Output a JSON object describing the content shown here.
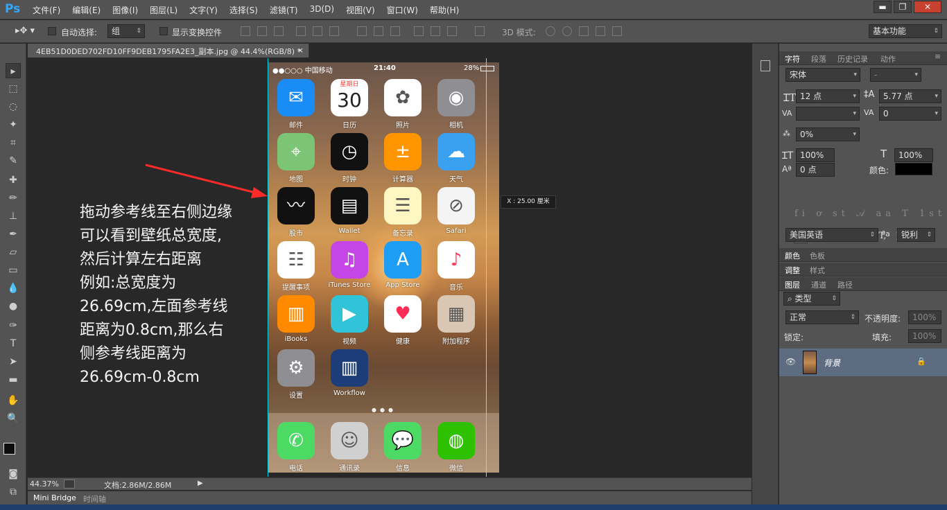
{
  "app": {
    "logo": "Ps",
    "workspace": "基本功能"
  },
  "menu": [
    "文件(F)",
    "编辑(E)",
    "图像(I)",
    "图层(L)",
    "文字(Y)",
    "选择(S)",
    "滤镜(T)",
    "3D(D)",
    "视图(V)",
    "窗口(W)",
    "帮助(H)"
  ],
  "window_controls": {
    "minimize": "▬",
    "restore": "❐",
    "close": "✕"
  },
  "options": {
    "auto_select_label": "自动选择:",
    "auto_select_value": "组",
    "transform_label": "显示变换控件",
    "mode3d_label": "3D 模式:"
  },
  "document": {
    "tab_title": "4EB51D0DED702FD10FF9DEB1795FA2E3_副本.jpg @ 44.4%(RGB/8) *",
    "close": "×"
  },
  "status": {
    "zoom": "44.37%",
    "doc_info": "文档:2.86M/2.86M"
  },
  "bottom_tabs": [
    "Mini Bridge",
    "时间轴"
  ],
  "tooltip": "X : 25.00 厘米",
  "annotation": [
    "拖动参考线至右侧边缘",
    "可以看到壁纸总宽度,",
    "然后计算左右距离",
    "例如:总宽度为",
    "26.69cm,左面参考线",
    "距离为0.8cm,那么右",
    "侧参考线距离为",
    "26.69cm-0.8cm"
  ],
  "phone": {
    "carrier": "●●○○○ 中国移动",
    "time": "21:40",
    "battery": "28%",
    "calendar_weekday": "星期日",
    "calendar_day": "30",
    "apps": [
      {
        "name": "邮件",
        "icon": "mail-icon",
        "color": "#1a8cf5"
      },
      {
        "name": "日历",
        "icon": "calendar-icon",
        "color": "#ffffff"
      },
      {
        "name": "照片",
        "icon": "photos-icon",
        "color": "#ffffff"
      },
      {
        "name": "相机",
        "icon": "camera-icon",
        "color": "#8e8e93"
      },
      {
        "name": "地图",
        "icon": "maps-icon",
        "color": "#7cc576"
      },
      {
        "name": "时钟",
        "icon": "clock-icon",
        "color": "#111111"
      },
      {
        "name": "计算器",
        "icon": "calculator-icon",
        "color": "#ff9500"
      },
      {
        "name": "天气",
        "icon": "weather-icon",
        "color": "#3aa0f0"
      },
      {
        "name": "股市",
        "icon": "stocks-icon",
        "color": "#111111"
      },
      {
        "name": "Wallet",
        "icon": "wallet-icon",
        "color": "#111111"
      },
      {
        "name": "备忘录",
        "icon": "notes-icon",
        "color": "#fef7c3"
      },
      {
        "name": "Safari",
        "icon": "safari-icon",
        "color": "#f4f4f4"
      },
      {
        "name": "提醒事项",
        "icon": "reminders-icon",
        "color": "#ffffff"
      },
      {
        "name": "iTunes Store",
        "icon": "itunes-icon",
        "color": "#c645e6"
      },
      {
        "name": "App Store",
        "icon": "appstore-icon",
        "color": "#1e9df4"
      },
      {
        "name": "音乐",
        "icon": "music-icon",
        "color": "#ffffff"
      },
      {
        "name": "iBooks",
        "icon": "ibooks-icon",
        "color": "#ff8a00"
      },
      {
        "name": "视频",
        "icon": "video-icon",
        "color": "#31c4d8"
      },
      {
        "name": "健康",
        "icon": "health-icon",
        "color": "#ffffff"
      },
      {
        "name": "附加程序",
        "icon": "extras-folder-icon",
        "color": "#d9c7b3"
      },
      {
        "name": "设置",
        "icon": "settings-icon",
        "color": "#8e8e93"
      },
      {
        "name": "Workflow",
        "icon": "workflow-icon",
        "color": "#1c3d78"
      }
    ],
    "dock": [
      {
        "name": "电话",
        "icon": "phone-icon",
        "color": "#4cd964"
      },
      {
        "name": "通讯录",
        "icon": "contacts-icon",
        "color": "#d0d0d0"
      },
      {
        "name": "信息",
        "icon": "messages-icon",
        "color": "#4cd964"
      },
      {
        "name": "微信",
        "icon": "wechat-icon",
        "color": "#2dc100"
      }
    ]
  },
  "character_panel": {
    "tabs": [
      "字符",
      "段落",
      "历史记录",
      "动作"
    ],
    "font": "宋体",
    "font_style": "-",
    "size": "12 点",
    "leading": "5.77 点",
    "kerning": "",
    "tracking": "0",
    "scale_pct": "0%",
    "vscale": "100%",
    "hscale": "100%",
    "baseline": "0 点",
    "color_label": "颜色:",
    "language": "美国英语",
    "aa_label": "ªa",
    "antialias": "锐利"
  },
  "mid_tabs": {
    "color": [
      "颜色",
      "色板"
    ],
    "adjust": [
      "调整",
      "样式"
    ]
  },
  "layers_panel": {
    "tabs": [
      "图层",
      "通道",
      "路径"
    ],
    "filter": "类型",
    "blend": "正常",
    "opacity_label": "不透明度:",
    "opacity": "100%",
    "lock_label": "锁定:",
    "fill_label": "填充:",
    "fill": "100%",
    "layer_name": "背景"
  }
}
